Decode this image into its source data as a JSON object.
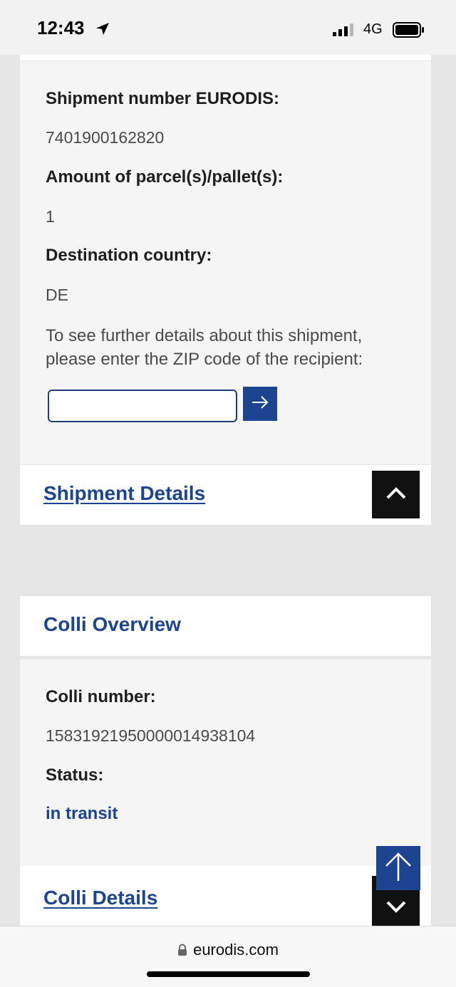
{
  "status_bar": {
    "time": "12:43",
    "network": "4G",
    "location_icon": "location-arrow-icon",
    "signal_icon": "cellular-signal-icon",
    "battery_icon": "battery-icon"
  },
  "shipment": {
    "number_label": "Shipment number EURODIS:",
    "number_value": "7401900162820",
    "amount_label": "Amount of parcel(s)/pallet(s):",
    "amount_value": "1",
    "destination_label": "Destination country:",
    "destination_value": "DE",
    "zip_prompt_line1": "To see further details about this shipment,",
    "zip_prompt_line2": "please enter the ZIP code of the recipient:",
    "zip_input_value": "",
    "zip_submit_icon": "arrow-right-icon",
    "details_link": "Shipment Details",
    "details_toggle_icon": "chevron-up-icon"
  },
  "colli": {
    "overview_title": "Colli Overview",
    "number_label": "Colli number:",
    "number_value": "15831921950000014938104",
    "status_label": "Status:",
    "status_value": "in transit",
    "details_link": "Colli Details",
    "details_toggle_icon": "chevron-down-icon"
  },
  "scroll_top_icon": "arrow-up-icon",
  "browser": {
    "url": "eurodis.com",
    "lock_icon": "lock-icon"
  },
  "colors": {
    "brand_blue": "#1d4490",
    "dark_button": "#111111",
    "page_background": "#e6e6e6"
  }
}
